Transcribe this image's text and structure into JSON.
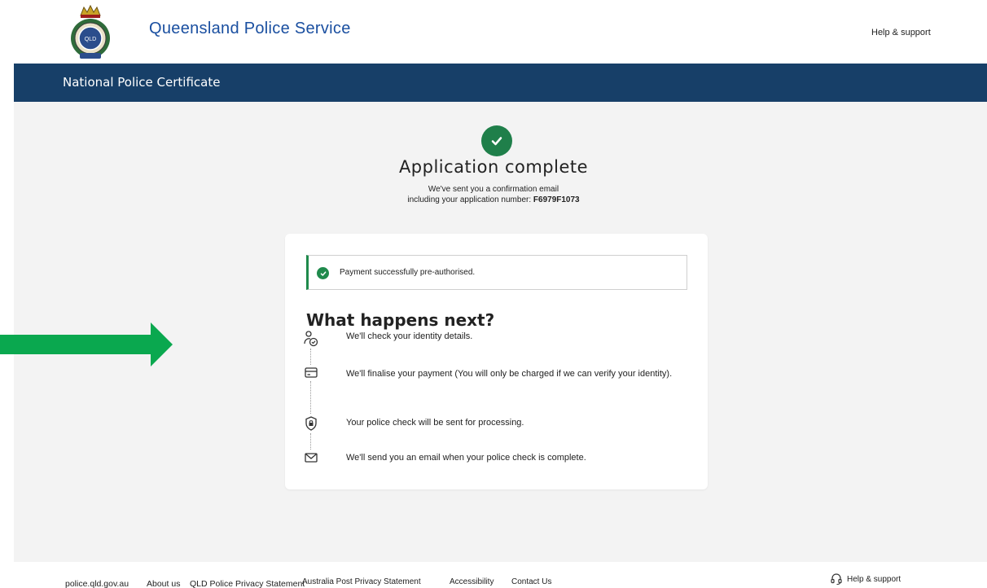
{
  "header": {
    "site_name": "Queensland Police Service",
    "help_link": "Help & support"
  },
  "banner": {
    "title": "National Police Certificate"
  },
  "confirmation": {
    "title": "Application complete",
    "line1": "We've sent you a confirmation email",
    "line2_prefix": "including your application number: ",
    "application_number": "F6979F1073"
  },
  "alert": {
    "text": "Payment successfully pre-authorised."
  },
  "next": {
    "heading": "What happens next?",
    "steps": [
      {
        "icon": "identity-check-icon",
        "text": "We'll check your identity details."
      },
      {
        "icon": "payment-card-icon",
        "text": "We'll finalise your payment (You will only be charged if we can verify your identity)."
      },
      {
        "icon": "security-shield-icon",
        "text": "Your police check will be sent for processing."
      },
      {
        "icon": "email-icon",
        "text": "We'll send you an email when your police check is complete."
      }
    ]
  },
  "footer": {
    "links": [
      "police.qld.gov.au",
      "About us",
      "QLD Police Privacy Statement",
      "Australia Post Privacy Statement",
      "Accessibility",
      "Contact Us"
    ],
    "help": "Help & support"
  },
  "colors": {
    "banner": "#173f68",
    "brand_blue": "#1a4fa0",
    "success_green": "#1f7f4a",
    "annotation_arrow": "#0aa84f",
    "page_background": "#f3f3f3"
  }
}
